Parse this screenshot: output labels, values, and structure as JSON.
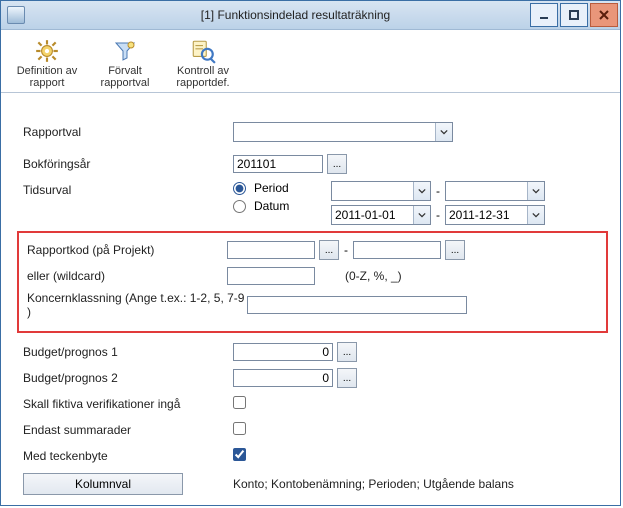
{
  "window": {
    "title": "[1]  Funktionsindelad resultaträkning"
  },
  "toolbar": {
    "items": [
      {
        "label": "Definition av rapport"
      },
      {
        "label": "Förvalt rapportval"
      },
      {
        "label": "Kontroll av rapportdef."
      }
    ]
  },
  "form": {
    "rapportval": {
      "label": "Rapportval",
      "value": ""
    },
    "bokforingsar": {
      "label": "Bokföringsår",
      "value": "201101"
    },
    "tidsurval": {
      "label": "Tidsurval",
      "radio_period": "Period",
      "radio_datum": "Datum",
      "selected": "period",
      "period_from": "",
      "period_to": "",
      "datum_from": "2011-01-01",
      "datum_to": "2011-12-31"
    },
    "rapportkod": {
      "label": "Rapportkod (på Projekt)",
      "from": "",
      "to": ""
    },
    "wildcard": {
      "label": "eller (wildcard)",
      "value": "",
      "hint": "(0-Z, %, _)"
    },
    "koncernklassning": {
      "label": "Koncernklassning (Ange t.ex.: 1-2, 5, 7-9 )",
      "value": ""
    },
    "budget1": {
      "label": "Budget/prognos 1",
      "value": "0"
    },
    "budget2": {
      "label": "Budget/prognos 2",
      "value": "0"
    },
    "fiktiva": {
      "label": "Skall fiktiva verifikationer ingå",
      "checked": false
    },
    "summarader": {
      "label": "Endast summarader",
      "checked": false
    },
    "teckenbyte": {
      "label": "Med teckenbyte",
      "checked": true
    },
    "kolumnval_btn": "Kolumnval",
    "kolumninfo": "Konto; Kontobenämning; Perioden; Utgående balans"
  },
  "glyphs": {
    "picker": "..."
  }
}
